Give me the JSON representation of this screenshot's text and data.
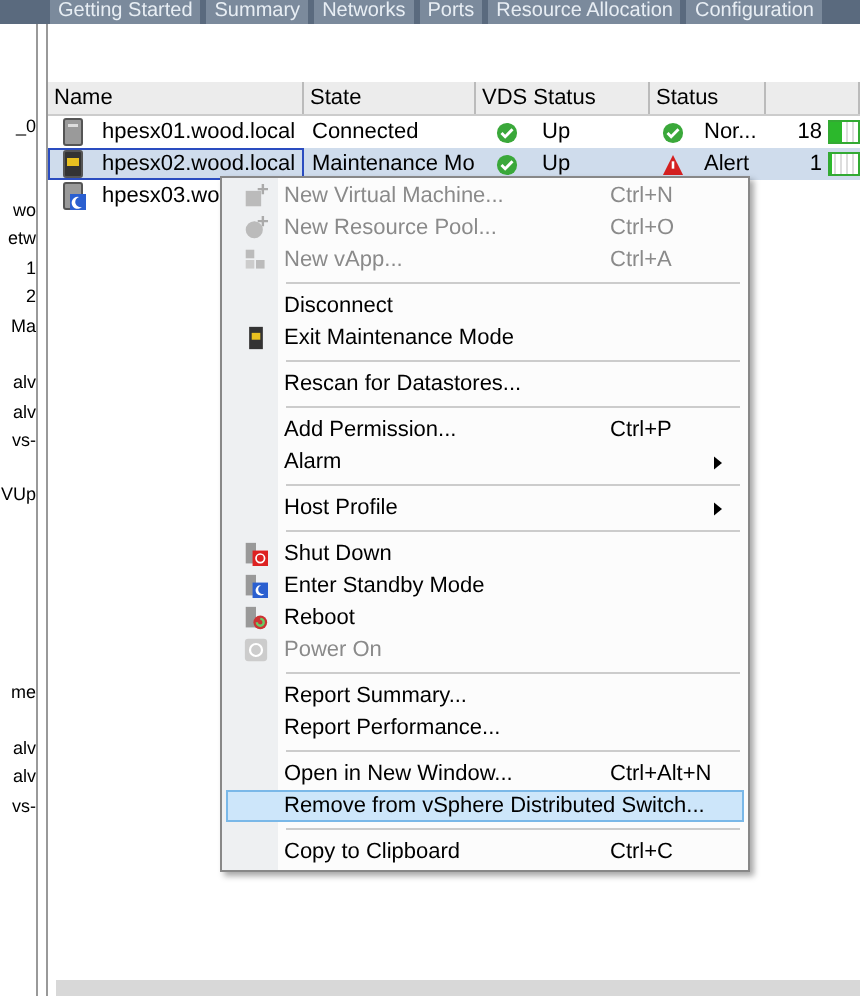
{
  "tabs": [
    {
      "label": "Getting Started",
      "selected": false
    },
    {
      "label": "Summary",
      "selected": false
    },
    {
      "label": "Networks",
      "selected": false
    },
    {
      "label": "Ports",
      "selected": false
    },
    {
      "label": "Resource Allocation",
      "selected": false
    },
    {
      "label": "Configuration",
      "selected": false
    }
  ],
  "left_panel": {
    "groups": [
      [
        "_0"
      ],
      [
        "wo",
        "etw",
        "1",
        "2",
        "Ma"
      ],
      [
        "alv",
        "alv",
        "vs-"
      ],
      [
        "VUp"
      ],
      [
        "me"
      ],
      [
        "alv",
        "alv",
        "vs-"
      ]
    ]
  },
  "table": {
    "columns": [
      "Name",
      "State",
      "VDS Status",
      "Status"
    ],
    "rows": [
      {
        "kind": "connected",
        "name": "hpesx01.wood.local",
        "state": "Connected",
        "vds_status": {
          "text": "Up",
          "kind": "ok"
        },
        "status": {
          "text": "Nor...",
          "kind": "ok"
        },
        "column_5": "18",
        "level": 0.45,
        "selected": false
      },
      {
        "kind": "maintenance",
        "name": "hpesx02.wood.local",
        "state": "Maintenance Mo",
        "vds_status": {
          "text": "Up",
          "kind": "ok"
        },
        "status": {
          "text": "Alert",
          "kind": "alert"
        },
        "column_5": "1",
        "level": 0.08,
        "selected": true
      },
      {
        "kind": "standby",
        "name": "hpesx03.wo",
        "selected": false
      }
    ]
  },
  "context_menu": [
    {
      "kind": "item",
      "label": "New Virtual Machine...",
      "shortcut": "Ctrl+N",
      "disabled": true,
      "selected": false
    },
    {
      "kind": "item",
      "label": "New Resource Pool...",
      "shortcut": "Ctrl+O",
      "disabled": true,
      "selected": false
    },
    {
      "kind": "item",
      "label": "New vApp...",
      "shortcut": "Ctrl+A",
      "disabled": true,
      "selected": false
    },
    {
      "kind": "separator"
    },
    {
      "kind": "item",
      "label": "Disconnect",
      "disabled": false,
      "selected": false
    },
    {
      "kind": "item",
      "label": "Exit Maintenance Mode",
      "disabled": false,
      "selected": false
    },
    {
      "kind": "separator"
    },
    {
      "kind": "item",
      "label": "Rescan for Datastores...",
      "disabled": false,
      "selected": false
    },
    {
      "kind": "separator"
    },
    {
      "kind": "item",
      "label": "Add Permission...",
      "shortcut": "Ctrl+P",
      "disabled": false,
      "selected": false
    },
    {
      "kind": "item",
      "label": "Alarm",
      "submenu": true,
      "disabled": false,
      "selected": false
    },
    {
      "kind": "separator"
    },
    {
      "kind": "item",
      "label": "Host Profile",
      "submenu": true,
      "disabled": false,
      "selected": false
    },
    {
      "kind": "separator"
    },
    {
      "kind": "item",
      "label": "Shut Down",
      "disabled": false,
      "selected": false
    },
    {
      "kind": "item",
      "label": "Enter Standby Mode",
      "disabled": false,
      "selected": false
    },
    {
      "kind": "item",
      "label": "Reboot",
      "disabled": false,
      "selected": false
    },
    {
      "kind": "item",
      "label": "Power On",
      "disabled": true,
      "selected": false
    },
    {
      "kind": "separator"
    },
    {
      "kind": "item",
      "label": "Report Summary...",
      "disabled": false,
      "selected": false
    },
    {
      "kind": "item",
      "label": "Report Performance...",
      "disabled": false,
      "selected": false
    },
    {
      "kind": "separator"
    },
    {
      "kind": "item",
      "label": "Open in New Window...",
      "shortcut": "Ctrl+Alt+N",
      "disabled": false,
      "selected": false
    },
    {
      "kind": "item",
      "label": "Remove from vSphere Distributed Switch...",
      "disabled": false,
      "selected": true
    },
    {
      "kind": "separator"
    },
    {
      "kind": "item",
      "label": "Copy to Clipboard",
      "shortcut": "Ctrl+C",
      "disabled": false,
      "selected": false
    }
  ]
}
